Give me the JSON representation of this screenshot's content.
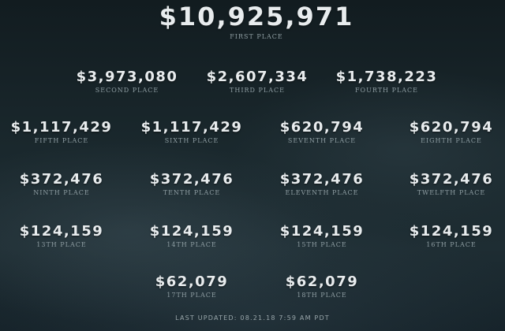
{
  "prizes": [
    {
      "amount": "$10,925,971",
      "place": "FIRST PLACE"
    },
    {
      "amount": "$3,973,080",
      "place": "SECOND PLACE"
    },
    {
      "amount": "$2,607,334",
      "place": "THIRD PLACE"
    },
    {
      "amount": "$1,738,223",
      "place": "FOURTH PLACE"
    },
    {
      "amount": "$1,117,429",
      "place": "FIFTH PLACE"
    },
    {
      "amount": "$1,117,429",
      "place": "SIXTH PLACE"
    },
    {
      "amount": "$620,794",
      "place": "SEVENTH PLACE"
    },
    {
      "amount": "$620,794",
      "place": "EIGHTH PLACE"
    },
    {
      "amount": "$372,476",
      "place": "NINTH PLACE"
    },
    {
      "amount": "$372,476",
      "place": "TENTH PLACE"
    },
    {
      "amount": "$372,476",
      "place": "ELEVENTH PLACE"
    },
    {
      "amount": "$372,476",
      "place": "TWELFTH PLACE"
    },
    {
      "amount": "$124,159",
      "place": "13TH PLACE"
    },
    {
      "amount": "$124,159",
      "place": "14TH PLACE"
    },
    {
      "amount": "$124,159",
      "place": "15TH PLACE"
    },
    {
      "amount": "$124,159",
      "place": "16TH PLACE"
    },
    {
      "amount": "$62,079",
      "place": "17TH PLACE"
    },
    {
      "amount": "$62,079",
      "place": "18TH PLACE"
    }
  ],
  "last_updated": "LAST UPDATED: 08.21.18 7:59 AM PDT"
}
